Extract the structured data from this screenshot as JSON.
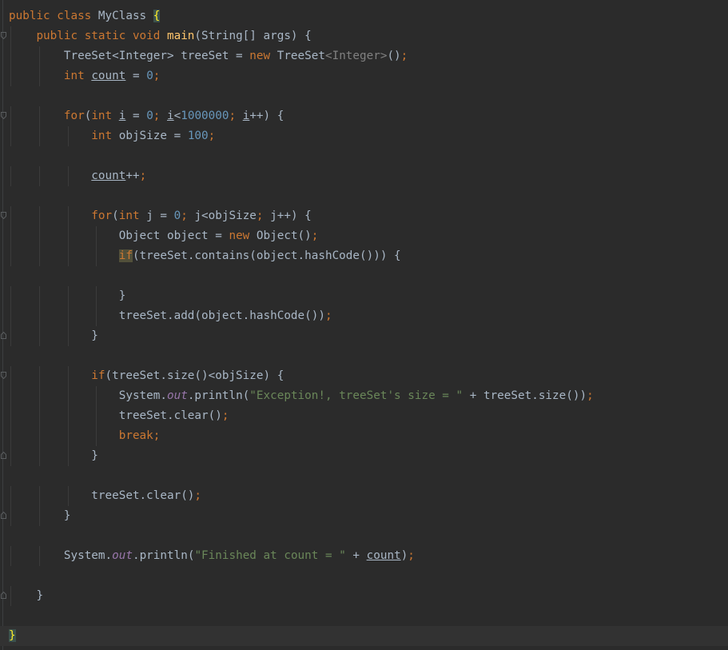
{
  "lines": [
    [
      {
        "t": "public class ",
        "c": "t-kw"
      },
      {
        "t": "MyClass ",
        "c": "t-id"
      },
      {
        "t": "{",
        "c": "t-brace-hl"
      }
    ],
    [
      {
        "t": "    "
      },
      {
        "t": "public static void ",
        "c": "t-kw"
      },
      {
        "t": "main",
        "c": "t-fn"
      },
      {
        "t": "(String[] args) {",
        "c": "t-id"
      }
    ],
    [
      {
        "t": "        "
      },
      {
        "t": "TreeSet<Integer> treeSet = ",
        "c": "t-id"
      },
      {
        "t": "new ",
        "c": "t-kw"
      },
      {
        "t": "TreeSet",
        "c": "t-id"
      },
      {
        "t": "<Integer>",
        "c": "t-gen"
      },
      {
        "t": "()",
        "c": "t-id"
      },
      {
        "t": ";",
        "c": "t-punc"
      }
    ],
    [
      {
        "t": "        "
      },
      {
        "t": "int ",
        "c": "t-kw"
      },
      {
        "t": "count",
        "c": "t-id t-ul"
      },
      {
        "t": " = ",
        "c": "t-id"
      },
      {
        "t": "0",
        "c": "t-num"
      },
      {
        "t": ";",
        "c": "t-punc"
      }
    ],
    [],
    [
      {
        "t": "        "
      },
      {
        "t": "for",
        "c": "t-kw"
      },
      {
        "t": "(",
        "c": "t-id"
      },
      {
        "t": "int ",
        "c": "t-kw"
      },
      {
        "t": "i",
        "c": "t-id t-ul"
      },
      {
        "t": " = ",
        "c": "t-id"
      },
      {
        "t": "0",
        "c": "t-num"
      },
      {
        "t": "; ",
        "c": "t-punc"
      },
      {
        "t": "i",
        "c": "t-id t-ul"
      },
      {
        "t": "<",
        "c": "t-id"
      },
      {
        "t": "1000000",
        "c": "t-num"
      },
      {
        "t": "; ",
        "c": "t-punc"
      },
      {
        "t": "i",
        "c": "t-id t-ul"
      },
      {
        "t": "++) {",
        "c": "t-id"
      }
    ],
    [
      {
        "t": "            "
      },
      {
        "t": "int ",
        "c": "t-kw"
      },
      {
        "t": "objSize = ",
        "c": "t-id"
      },
      {
        "t": "100",
        "c": "t-num"
      },
      {
        "t": ";",
        "c": "t-punc"
      }
    ],
    [],
    [
      {
        "t": "            "
      },
      {
        "t": "count",
        "c": "t-id t-ul"
      },
      {
        "t": "++",
        "c": "t-id"
      },
      {
        "t": ";",
        "c": "t-punc"
      }
    ],
    [],
    [
      {
        "t": "            "
      },
      {
        "t": "for",
        "c": "t-kw"
      },
      {
        "t": "(",
        "c": "t-id"
      },
      {
        "t": "int ",
        "c": "t-kw"
      },
      {
        "t": "j = ",
        "c": "t-id"
      },
      {
        "t": "0",
        "c": "t-num"
      },
      {
        "t": "; ",
        "c": "t-punc"
      },
      {
        "t": "j<objSize",
        "c": "t-id"
      },
      {
        "t": "; ",
        "c": "t-punc"
      },
      {
        "t": "j++) {",
        "c": "t-id"
      }
    ],
    [
      {
        "t": "                "
      },
      {
        "t": "Object object = ",
        "c": "t-id"
      },
      {
        "t": "new ",
        "c": "t-kw"
      },
      {
        "t": "Object()",
        "c": "t-id"
      },
      {
        "t": ";",
        "c": "t-punc"
      }
    ],
    [
      {
        "t": "                "
      },
      {
        "t": "if",
        "c": "t-if-hl"
      },
      {
        "t": "(treeSet.contains(object.hashCode())) {",
        "c": "t-id"
      }
    ],
    [],
    [
      {
        "t": "                "
      },
      {
        "t": "}",
        "c": "t-id"
      }
    ],
    [
      {
        "t": "                "
      },
      {
        "t": "treeSet.add(object.hashCode())",
        "c": "t-id"
      },
      {
        "t": ";",
        "c": "t-punc"
      }
    ],
    [
      {
        "t": "            "
      },
      {
        "t": "}",
        "c": "t-id"
      }
    ],
    [],
    [
      {
        "t": "            "
      },
      {
        "t": "if",
        "c": "t-kw"
      },
      {
        "t": "(treeSet.size()<objSize) {",
        "c": "t-id"
      }
    ],
    [
      {
        "t": "                "
      },
      {
        "t": "System.",
        "c": "t-id"
      },
      {
        "t": "out",
        "c": "t-static"
      },
      {
        "t": ".println(",
        "c": "t-id"
      },
      {
        "t": "\"Exception!, treeSet's size = \"",
        "c": "t-str"
      },
      {
        "t": " + treeSet.size())",
        "c": "t-id"
      },
      {
        "t": ";",
        "c": "t-punc"
      }
    ],
    [
      {
        "t": "                "
      },
      {
        "t": "treeSet.clear()",
        "c": "t-id"
      },
      {
        "t": ";",
        "c": "t-punc"
      }
    ],
    [
      {
        "t": "                "
      },
      {
        "t": "break;",
        "c": "t-kw"
      }
    ],
    [
      {
        "t": "            "
      },
      {
        "t": "}",
        "c": "t-id"
      }
    ],
    [],
    [
      {
        "t": "            "
      },
      {
        "t": "treeSet.clear()",
        "c": "t-id"
      },
      {
        "t": ";",
        "c": "t-punc"
      }
    ],
    [
      {
        "t": "        "
      },
      {
        "t": "}",
        "c": "t-id"
      }
    ],
    [],
    [
      {
        "t": "        "
      },
      {
        "t": "System.",
        "c": "t-id"
      },
      {
        "t": "out",
        "c": "t-static"
      },
      {
        "t": ".println(",
        "c": "t-id"
      },
      {
        "t": "\"Finished at count = \"",
        "c": "t-str"
      },
      {
        "t": " + ",
        "c": "t-id"
      },
      {
        "t": "count",
        "c": "t-id t-ul"
      },
      {
        "t": ")",
        "c": "t-id"
      },
      {
        "t": ";",
        "c": "t-punc"
      }
    ],
    [],
    [
      {
        "t": "    "
      },
      {
        "t": "}",
        "c": "t-id"
      }
    ],
    [],
    [
      {
        "t": "}",
        "c": "t-brace-hl"
      }
    ]
  ],
  "current_line": 31,
  "fold_open_lines": [
    1,
    5,
    10,
    18
  ],
  "fold_close_lines": [
    16,
    22,
    25,
    29
  ]
}
